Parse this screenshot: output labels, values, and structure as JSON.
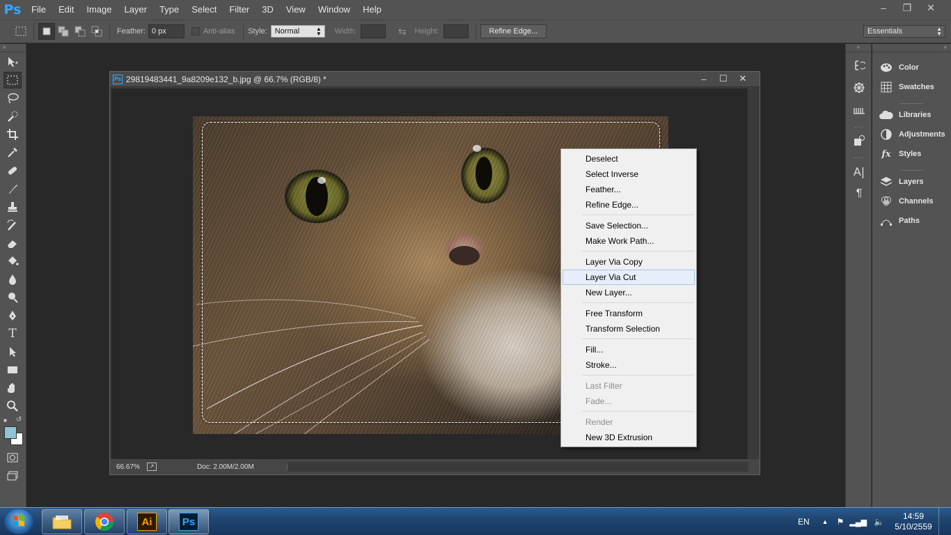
{
  "app": {
    "logo": "Ps",
    "menu": [
      "File",
      "Edit",
      "Image",
      "Layer",
      "Type",
      "Select",
      "Filter",
      "3D",
      "View",
      "Window",
      "Help"
    ],
    "window_controls": [
      "minimize",
      "restore",
      "close"
    ]
  },
  "options": {
    "feather_label": "Feather:",
    "feather_value": "0 px",
    "antialias_label": "Anti-alias",
    "style_label": "Style:",
    "style_value": "Normal",
    "width_label": "Width:",
    "height_label": "Height:",
    "refine_edge_button": "Refine Edge...",
    "workspace_value": "Essentials"
  },
  "document": {
    "title": "29819483441_9a8209e132_b.jpg @ 66.7% (RGB/8) *",
    "zoom": "66.67%",
    "doc_size": "Doc: 2.00M/2.00M"
  },
  "context_menu": {
    "groups": [
      [
        {
          "label": "Deselect"
        },
        {
          "label": "Select Inverse"
        },
        {
          "label": "Feather..."
        },
        {
          "label": "Refine Edge..."
        }
      ],
      [
        {
          "label": "Save Selection..."
        },
        {
          "label": "Make Work Path..."
        }
      ],
      [
        {
          "label": "Layer Via Copy"
        },
        {
          "label": "Layer Via Cut",
          "hover": true
        },
        {
          "label": "New Layer..."
        }
      ],
      [
        {
          "label": "Free Transform"
        },
        {
          "label": "Transform Selection"
        }
      ],
      [
        {
          "label": "Fill..."
        },
        {
          "label": "Stroke..."
        }
      ],
      [
        {
          "label": "Last Filter",
          "disabled": true
        },
        {
          "label": "Fade...",
          "disabled": true
        }
      ],
      [
        {
          "label": "Render",
          "disabled": true
        },
        {
          "label": "New 3D Extrusion"
        }
      ]
    ]
  },
  "panels": {
    "group1": [
      {
        "label": "Color",
        "icon": "color-icon"
      },
      {
        "label": "Swatches",
        "icon": "swatches-icon"
      }
    ],
    "group2": [
      {
        "label": "Libraries",
        "icon": "libraries-icon"
      },
      {
        "label": "Adjustments",
        "icon": "adjustments-icon"
      },
      {
        "label": "Styles",
        "icon": "styles-icon"
      }
    ],
    "group3": [
      {
        "label": "Layers",
        "icon": "layers-icon"
      },
      {
        "label": "Channels",
        "icon": "channels-icon"
      },
      {
        "label": "Paths",
        "icon": "paths-icon"
      }
    ]
  },
  "taskbar": {
    "apps": [
      "file-explorer",
      "chrome",
      "illustrator",
      "photoshop"
    ],
    "illustrator_label": "Ai",
    "photoshop_label": "Ps",
    "language": "EN",
    "time": "14:59",
    "date": "5/10/2559"
  },
  "colors": {
    "ps_blue": "#31a8ff",
    "foreground_swatch": "#8fc6d6",
    "background_swatch": "#ffffff",
    "menu_hover": "#e5eef9"
  }
}
